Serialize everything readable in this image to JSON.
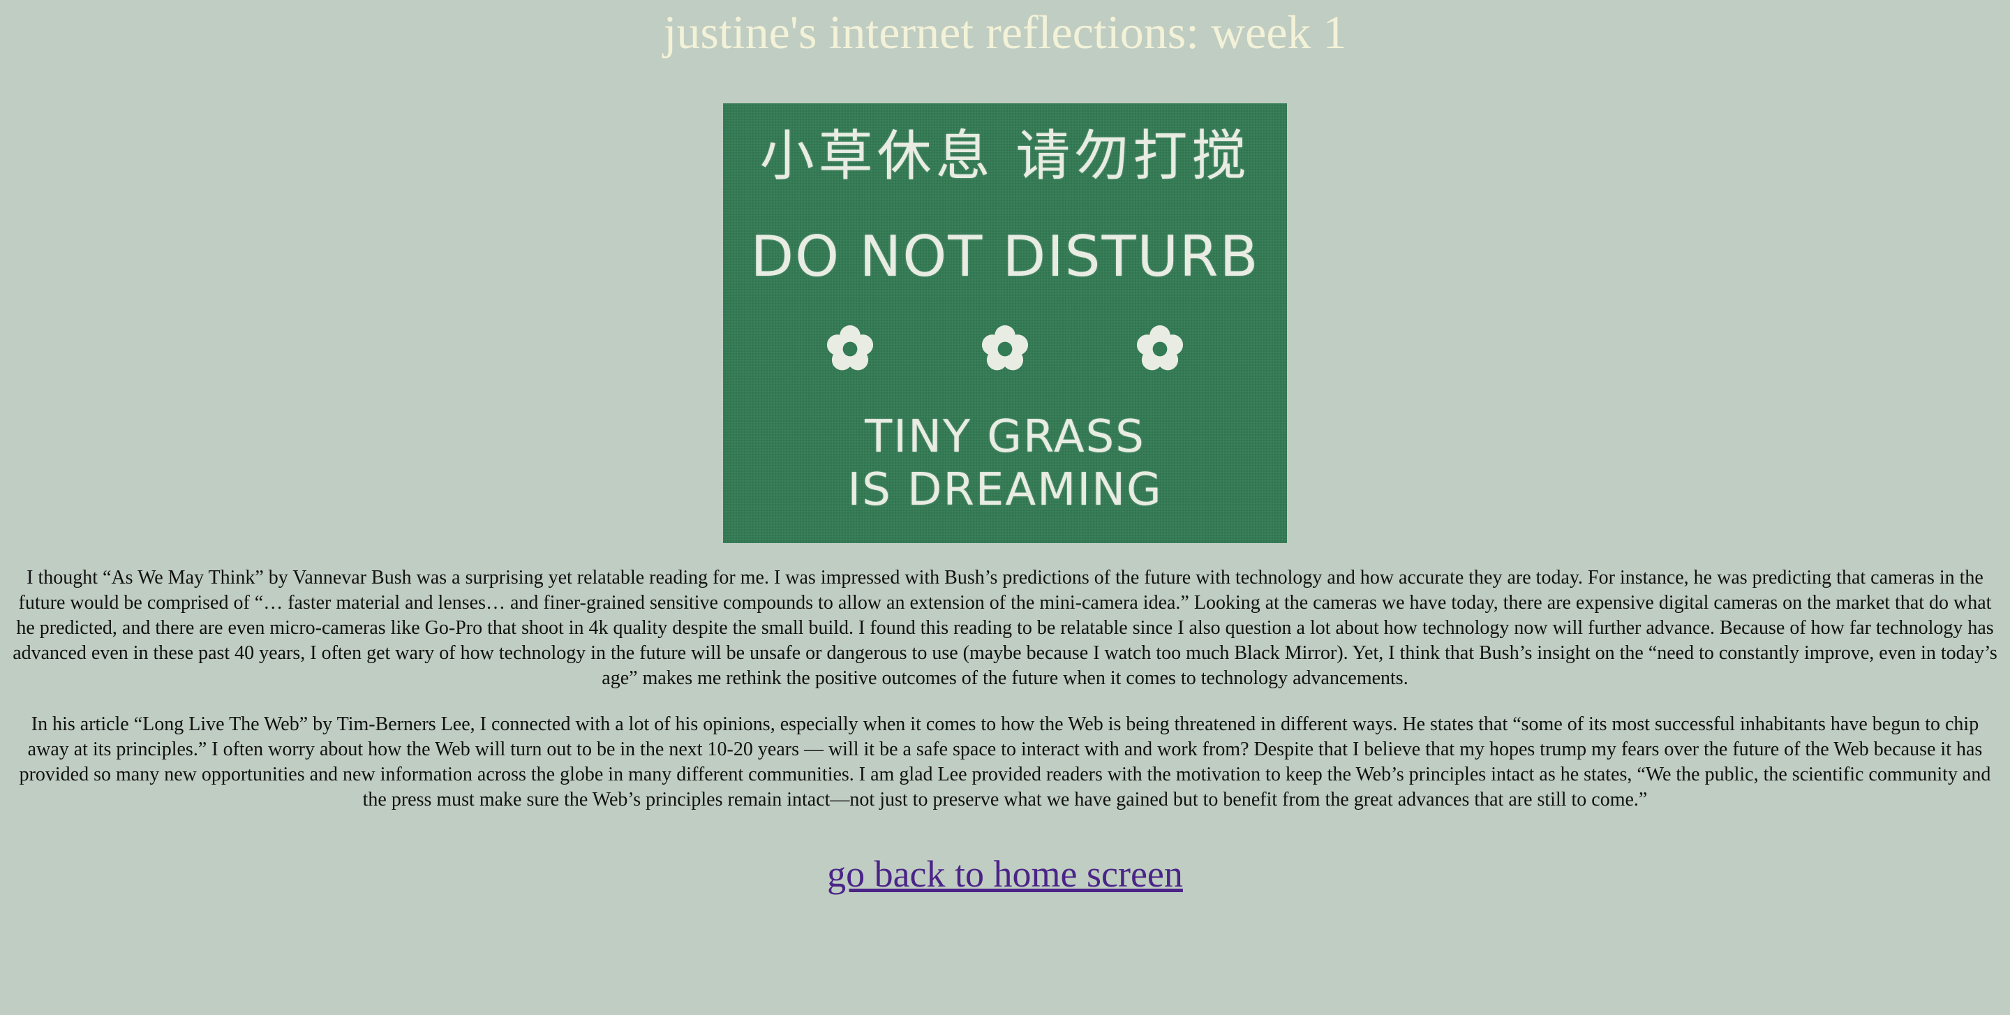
{
  "page": {
    "title": "justine's internet reflections: week 1"
  },
  "hero_image": {
    "chinese_text": "小草休息  请勿打搅",
    "line_1": "DO NOT DISTURB",
    "line_2": "TINY GRASS",
    "line_3": "IS DREAMING",
    "icons": [
      "flower-icon",
      "flower-icon",
      "flower-icon"
    ],
    "background_color": "#327b54"
  },
  "paragraphs": [
    "I thought “As We May Think” by Vannevar Bush was a surprising yet relatable reading for me. I was impressed with Bush’s predictions of the future with technology and how accurate they are today. For instance, he was predicting that cameras in the future would be comprised of “… faster material and lenses… and finer-grained sensitive compounds to allow an extension of the mini-camera idea.” Looking at the cameras we have today, there are expensive digital cameras on the market that do what he predicted, and there are even micro-cameras like Go-Pro that shoot in 4k quality despite the small build. I found this reading to be relatable since I also question a lot about how technology now will further advance. Because of how far technology has advanced even in these past 40 years, I often get wary of how technology in the future will be unsafe or dangerous to use (maybe because I watch too much Black Mirror). Yet, I think that Bush’s insight on the “need to constantly improve, even in today’s age” makes me rethink the positive outcomes of the future when it comes to technology advancements.",
    "In his article “Long Live The Web” by Tim-Berners Lee, I connected with a lot of his opinions, especially when it comes to how the Web is being threatened in different ways. He states that “some of its most successful inhabitants have begun to chip away at its principles.” I often worry about how the Web will turn out to be in the next 10-20 years — will it be a safe space to interact with and work from? Despite that I believe that my hopes trump my fears over the future of the Web because it has provided so many new opportunities and new information across the globe in many different communities. I am glad Lee provided readers with the motivation to keep the Web’s principles intact as he states, “We the public, the scientific community and the press must make sure the Web’s principles remain intact—not just to preserve what we have gained but to benefit from the great advances that are still to come.”"
  ],
  "nav": {
    "home_link": "go back to home screen"
  },
  "colors": {
    "background": "#c0cdc2",
    "title": "#f3f2d8",
    "link": "#4b2488",
    "body_text": "#111111"
  }
}
